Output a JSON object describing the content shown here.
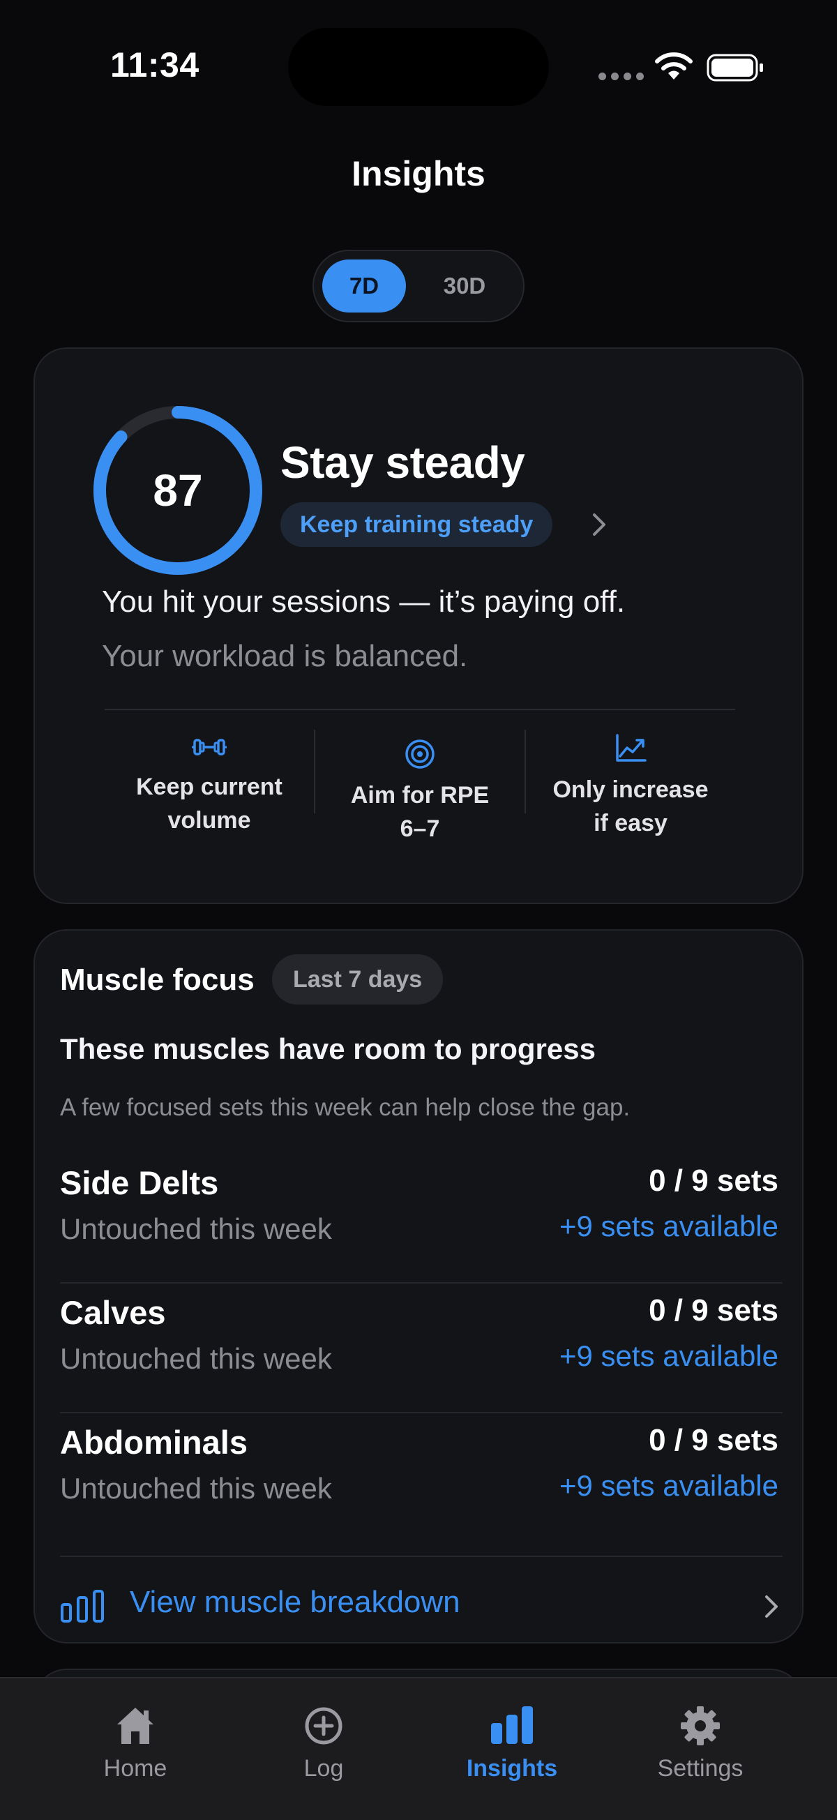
{
  "status_bar": {
    "time": "11:34"
  },
  "header": {
    "title": "Insights"
  },
  "period_selector": {
    "options": [
      "7D",
      "30D"
    ],
    "selected": "7D"
  },
  "score_card": {
    "score": "87",
    "score_fraction": 0.87,
    "title": "Stay steady",
    "pill": "Keep training steady",
    "line1": "You hit your sessions — it’s paying off.",
    "line2": "Your workload is balanced.",
    "tips": [
      {
        "icon": "dumbbell-icon",
        "line1": "Keep current",
        "line2": "volume"
      },
      {
        "icon": "target-icon",
        "line1": "Aim for RPE",
        "line2": "6–7"
      },
      {
        "icon": "trend-up-icon",
        "line1": "Only increase",
        "line2": "if easy"
      }
    ]
  },
  "muscle_focus": {
    "title": "Muscle focus",
    "badge": "Last 7 days",
    "headline": "These muscles have room to progress",
    "subtext": "A few focused sets this week can help close the gap.",
    "rows": [
      {
        "name": "Side Delts",
        "status": "Untouched this week",
        "sets": "0 / 9 sets",
        "available": "+9 sets available"
      },
      {
        "name": "Calves",
        "status": "Untouched this week",
        "sets": "0 / 9 sets",
        "available": "+9 sets available"
      },
      {
        "name": "Abdominals",
        "status": "Untouched this week",
        "sets": "0 / 9 sets",
        "available": "+9 sets available"
      }
    ],
    "link": "View muscle breakdown"
  },
  "tab_bar": {
    "items": [
      {
        "label": "Home",
        "icon": "home-icon"
      },
      {
        "label": "Log",
        "icon": "plus-circle-icon"
      },
      {
        "label": "Insights",
        "icon": "bar-chart-icon"
      },
      {
        "label": "Settings",
        "icon": "gear-icon"
      }
    ],
    "active": "Insights"
  },
  "colors": {
    "accent": "#3a8ff3",
    "background": "#09090b",
    "card": "#131418",
    "ring_track": "#2a2b30"
  }
}
